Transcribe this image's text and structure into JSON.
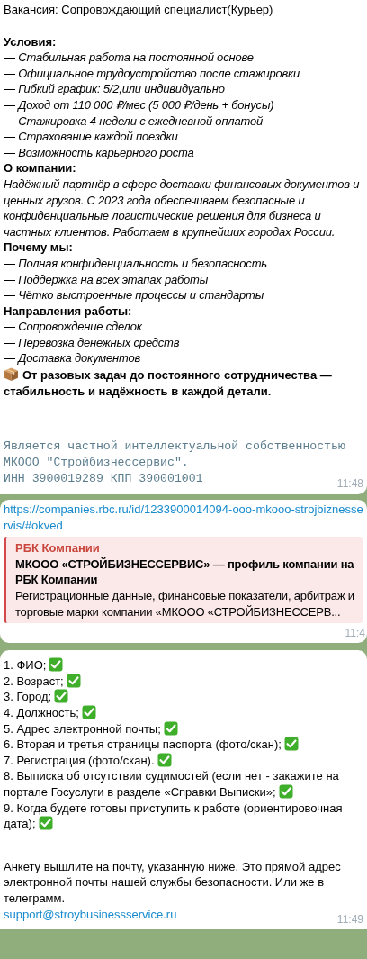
{
  "messages": [
    {
      "time": "11:48",
      "blocks": [
        {
          "kind": "title",
          "text": "Вакансия: Сопровождающий специалист(Курьер)"
        },
        {
          "kind": "heading",
          "text": "Условия:"
        },
        {
          "kind": "item",
          "text": "— Стабильная работа на постоянной основе"
        },
        {
          "kind": "item",
          "text": "— Официальное трудоустройство после стажировки"
        },
        {
          "kind": "item",
          "text": "— Гибкий график: 5/2,или индивидуально"
        },
        {
          "kind": "item",
          "text": "— Доход от 110 000 ₽/мес (5 000 ₽/день + бонусы)"
        },
        {
          "kind": "item",
          "text": "— Стажировка 4 недели с ежедневной оплатой"
        },
        {
          "kind": "item",
          "text": "— Страхование каждой поездки"
        },
        {
          "kind": "item",
          "text": "— Возможность карьерного роста"
        },
        {
          "kind": "heading",
          "text": "О компании:"
        },
        {
          "kind": "item",
          "text": "Надёжный партнёр в сфере доставки финансовых документов и ценных грузов. С 2023 года обеспечиваем безопасные и конфиденциальные логистические решения для бизнеса и частных клиентов. Работаем в крупнейших городах России."
        },
        {
          "kind": "heading",
          "text": "Почему мы:"
        },
        {
          "kind": "item",
          "text": "— Полная конфиденциальность и безопасность"
        },
        {
          "kind": "item",
          "text": "— Поддержка на всех этапах работы"
        },
        {
          "kind": "item",
          "text": "— Чётко выстроенные процессы и стандарты"
        },
        {
          "kind": "heading",
          "text": "Направления работы:"
        },
        {
          "kind": "item",
          "text": "— Сопровождение сделок"
        },
        {
          "kind": "item",
          "text": "— Перевозка денежных средств"
        },
        {
          "kind": "item",
          "text": "— Доставка документов"
        },
        {
          "kind": "boxed",
          "text": "От разовых задач до постоянного сотрудничества — стабильность и надёжность в каждой детали."
        },
        {
          "kind": "mono",
          "text": "Является частной интеллектуальной собственностью МКООО \"Стройбизнессервис\"."
        },
        {
          "kind": "mono_next",
          "text": "ИНН 3900019289 КПП 390001001"
        }
      ]
    },
    {
      "time": "11:4",
      "link": "https://companies.rbc.ru/id/1233900014094-ooo-mkooo-strojbiznesservis/#okved",
      "preview": {
        "site": "РБК Компании",
        "title": "МКООО «СТРОЙБИЗНЕССЕРВИС» — профиль компании на РБК Компании",
        "description": "Регистрационные данные, финансовые показатели, арбитраж и торговые марки компании «МКООО «СТРОЙБИЗНЕССЕРВ..."
      }
    },
    {
      "time": "11:49",
      "checklist": [
        {
          "text": "1. ФИО;",
          "checked": true
        },
        {
          "text": "2. Возраст;",
          "checked": true
        },
        {
          "text": "3. Город;",
          "checked": true
        },
        {
          "text": "4. Должность;",
          "checked": true
        },
        {
          "text": "5. Адрес электронной почты;",
          "checked": true
        },
        {
          "text": "6. Вторая и третья страницы паспорта (фото/скан);",
          "checked": true
        },
        {
          "text": "7. Регистрация (фото/скан).",
          "checked": true
        },
        {
          "text": "8. Выписка об отсутствии судимостей (если нет - закажите на портале Госуслуги в разделе  «Справки Выписки»;",
          "checked": true
        },
        {
          "text": "9. Когда будете готовы приступить к работе (ориентировочная дата);",
          "checked": true
        }
      ],
      "note": "Анкету вышлите на почту, указанную ниже. Это прямой адрес электронной почты нашей службы безопасности. Или же в телеграмм.",
      "email": "support@stroybusinessservice.ru"
    }
  ]
}
